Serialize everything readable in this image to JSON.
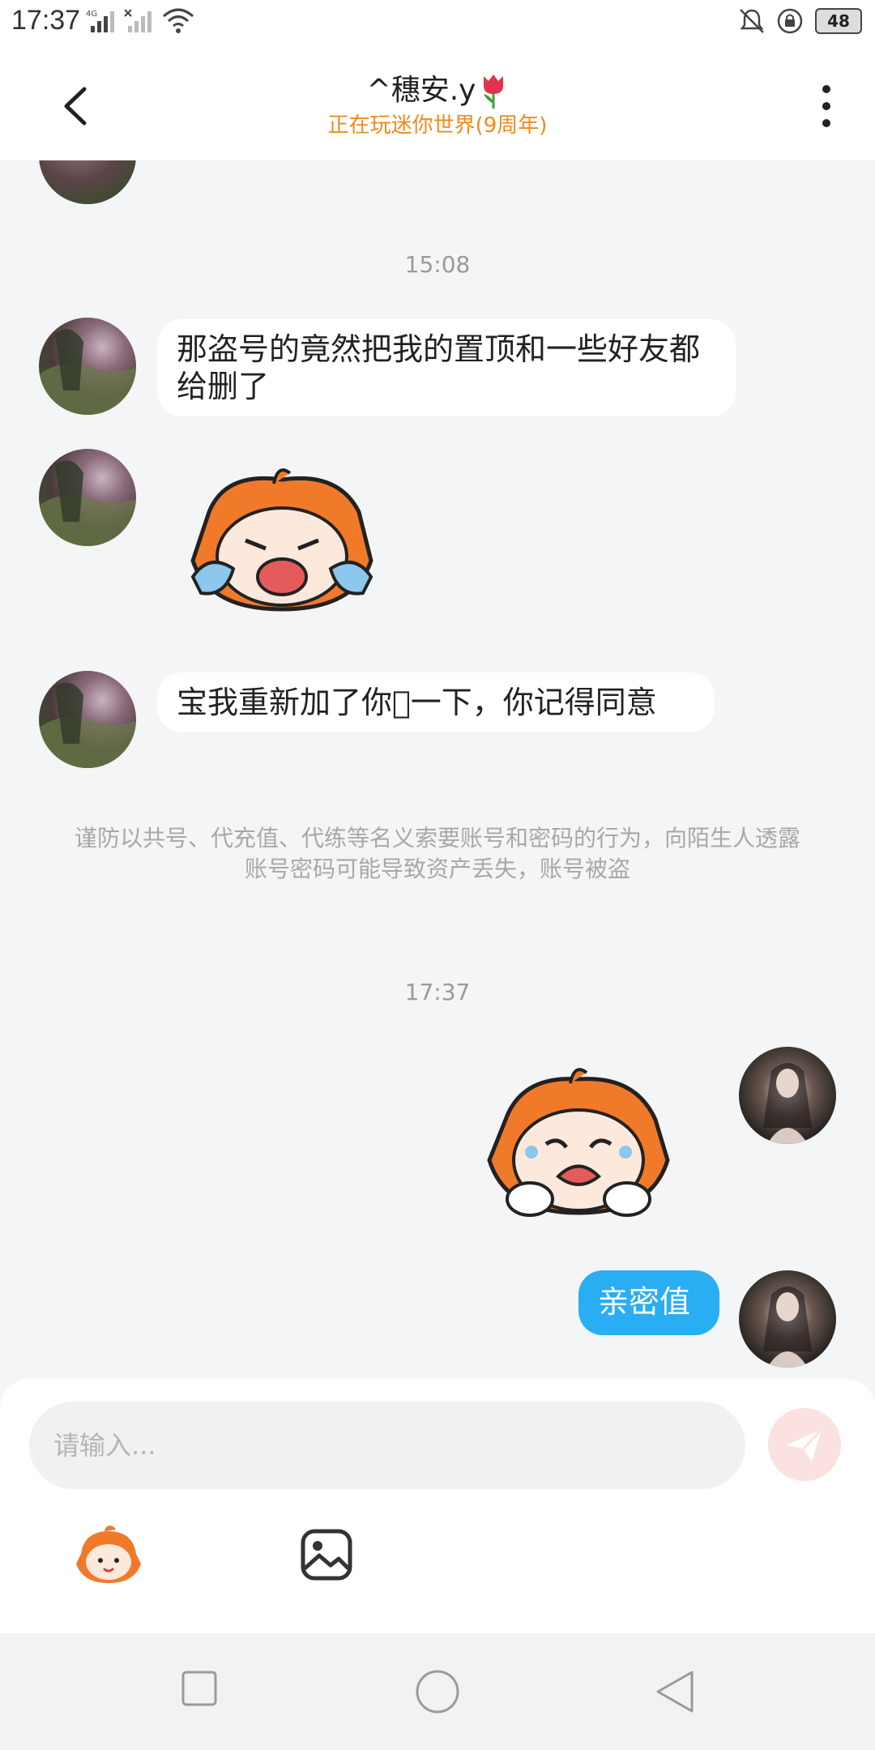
{
  "status_bar": {
    "time": "17:37",
    "network1": "4G",
    "battery": "48"
  },
  "header": {
    "title": "^穗安.y",
    "subtitle": "正在玩迷你世界(9周年)"
  },
  "messages": [
    {
      "type": "timestamp",
      "text": "15:08"
    },
    {
      "type": "text",
      "from": "other",
      "text": "那盗号的竟然把我的置顶和一些好友都给删了"
    },
    {
      "type": "sticker",
      "from": "other",
      "name": "crying-mascot-sticker"
    },
    {
      "type": "text",
      "from": "other",
      "text": "宝我重新加了你􀀀一下，你记得同意"
    },
    {
      "type": "notice",
      "text": "谨防以共号、代充值、代练等名义索要账号和密码的行为，向陌生人透露账号密码可能导致资产丢失，账号被盗"
    },
    {
      "type": "timestamp",
      "text": "17:37"
    },
    {
      "type": "sticker",
      "from": "self",
      "name": "crying-mascot-sticker"
    },
    {
      "type": "text",
      "from": "self",
      "text": "亲密值"
    }
  ],
  "input": {
    "placeholder": "请输入..."
  },
  "colors": {
    "accent_blue": "#29aef4",
    "subtitle_orange": "#f08a1c",
    "send_button_bg": "#fbe1df",
    "background": "#f4f5f7"
  },
  "icons": [
    "back-icon",
    "more-icon",
    "tulip-icon",
    "send-icon",
    "emoji-icon",
    "image-icon",
    "nav-square-icon",
    "nav-circle-icon",
    "nav-back-icon"
  ]
}
